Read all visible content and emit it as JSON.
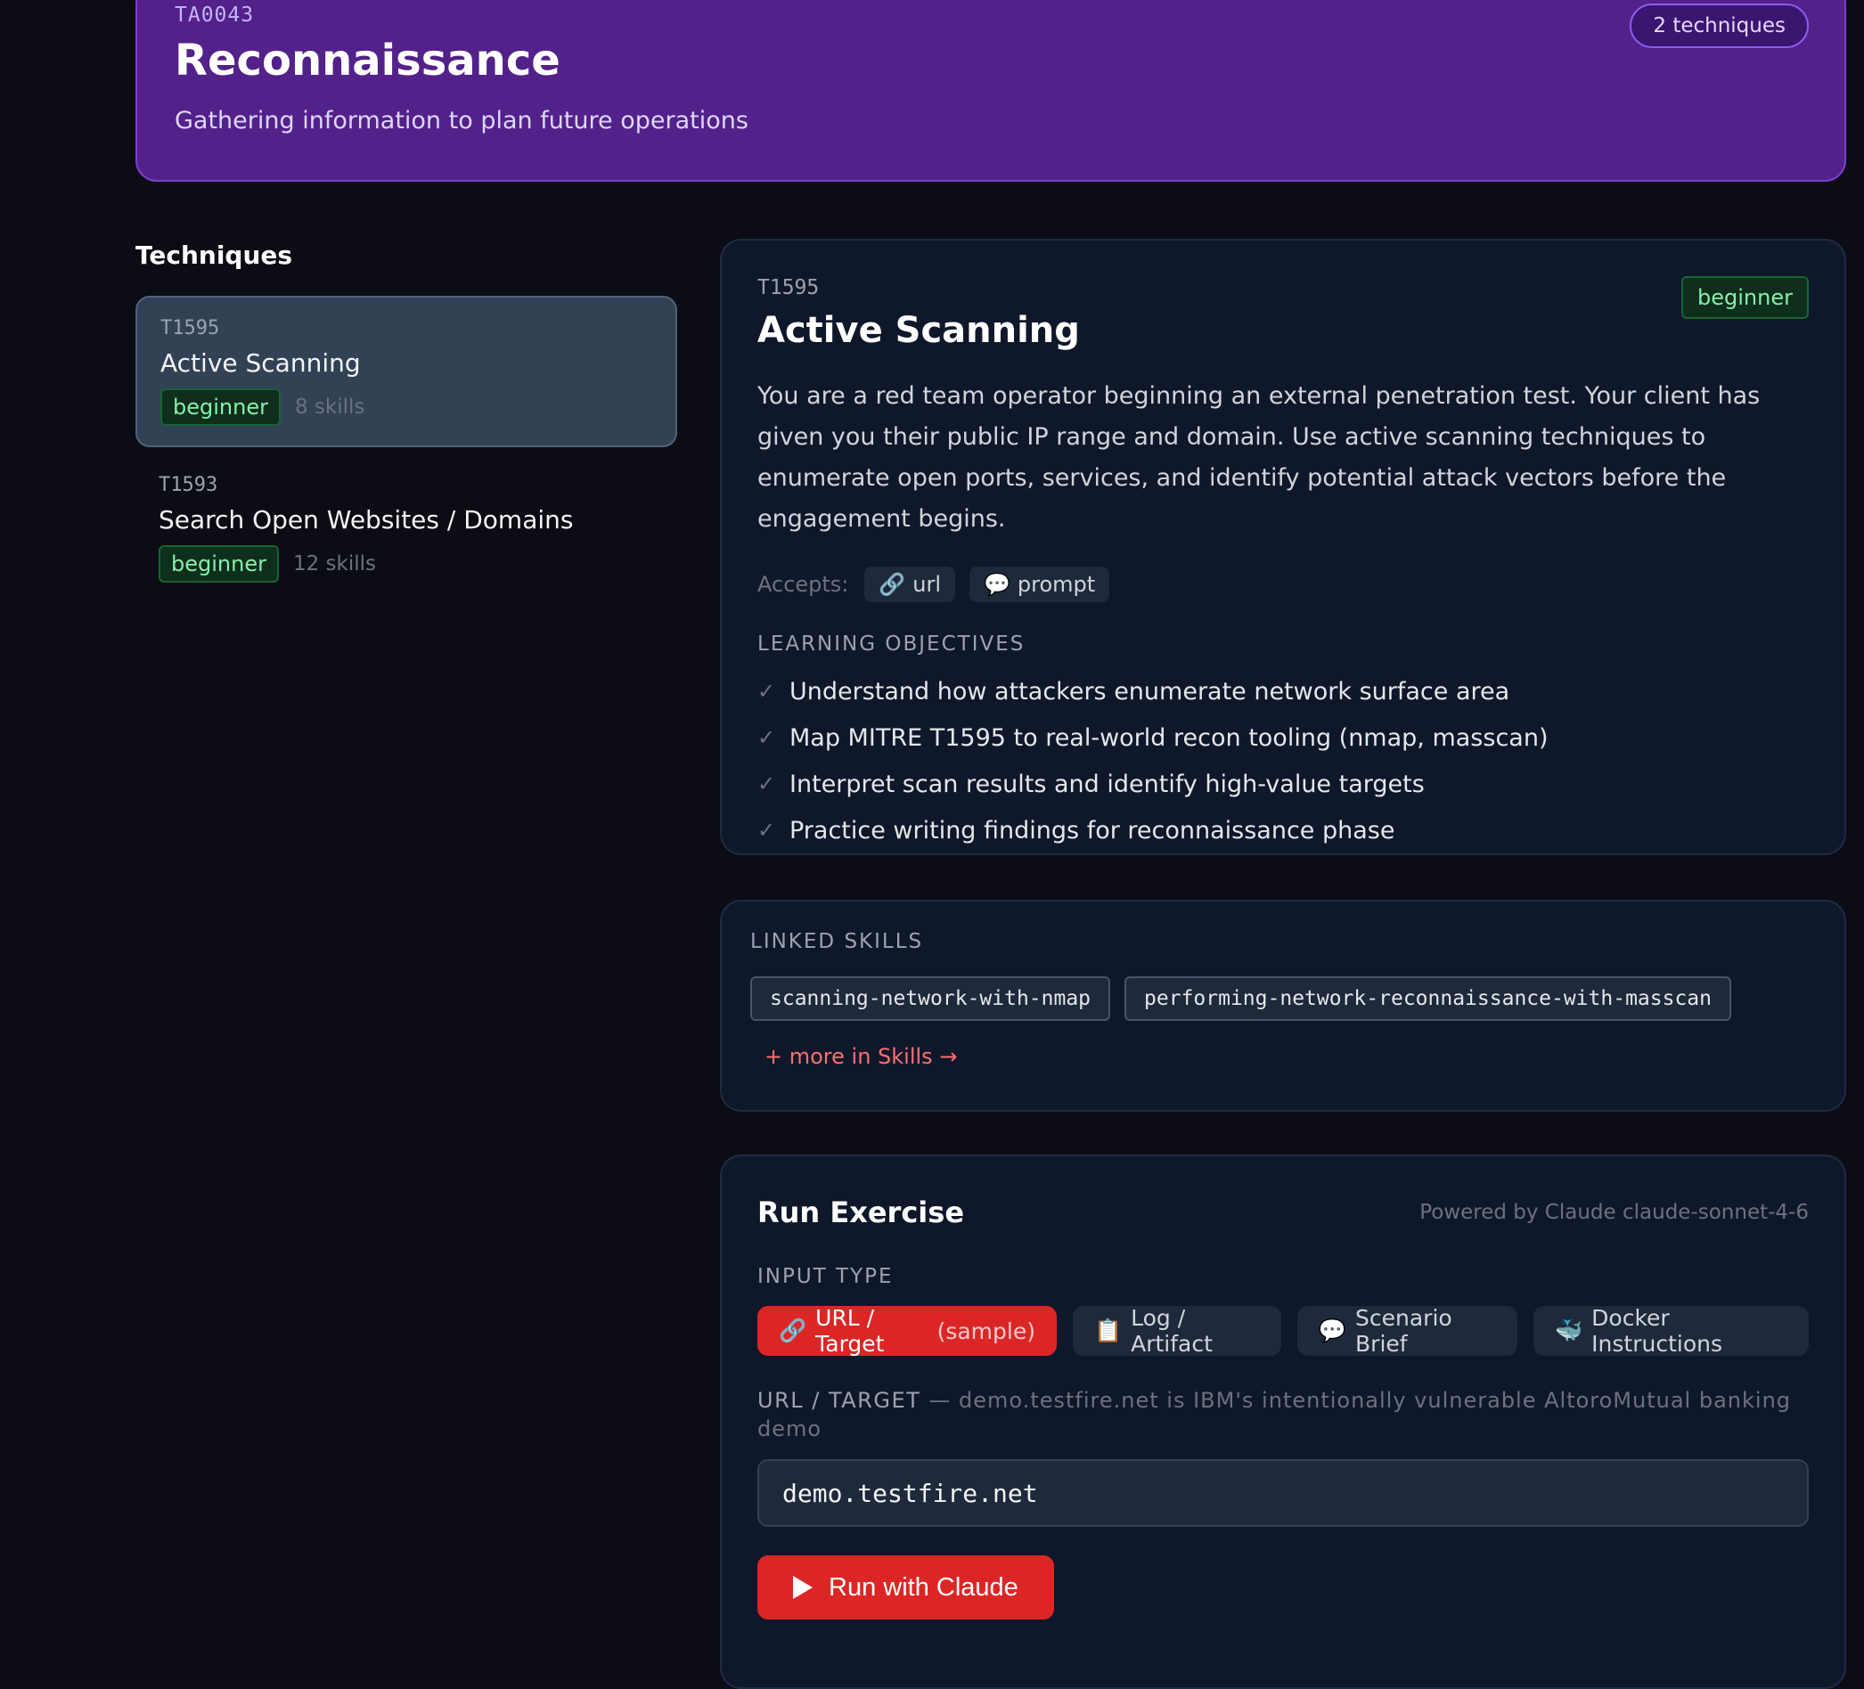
{
  "tactic": {
    "id": "TA0043",
    "title": "Reconnaissance",
    "description": "Gathering information to plan future operations",
    "technique_count": "2 techniques"
  },
  "techniques_heading": "Techniques",
  "techniques": [
    {
      "id": "T1595",
      "name": "Active Scanning",
      "level": "beginner",
      "skills": "8 skills",
      "active": true
    },
    {
      "id": "T1593",
      "name": "Search Open Websites / Domains",
      "level": "beginner",
      "skills": "12 skills",
      "active": false
    }
  ],
  "detail": {
    "id": "T1595",
    "title": "Active Scanning",
    "level": "beginner",
    "scenario": "You are a red team operator beginning an external penetration test. Your client has given you their public IP range and domain. Use active scanning techniques to enumerate open ports, services, and identify potential attack vectors before the engagement begins.",
    "accepts_label": "Accepts:",
    "accepts": [
      {
        "icon": "🔗",
        "label": "url"
      },
      {
        "icon": "💬",
        "label": "prompt"
      }
    ],
    "objectives_label": "LEARNING OBJECTIVES",
    "objectives": [
      "Understand how attackers enumerate network surface area",
      "Map MITRE T1595 to real-world recon tooling (nmap, masscan)",
      "Interpret scan results and identify high-value targets",
      "Practice writing findings for reconnaissance phase"
    ],
    "check_glyph": "✓"
  },
  "linked_skills": {
    "label": "LINKED SKILLS",
    "skills": [
      "scanning-network-with-nmap",
      "performing-network-reconnaissance-with-masscan"
    ],
    "more": "+ more in Skills →"
  },
  "run": {
    "title": "Run Exercise",
    "powered_by": "Powered by Claude claude-sonnet-4-6",
    "input_type_label": "INPUT TYPE",
    "tabs": [
      {
        "icon": "🔗",
        "label": "URL / Target",
        "extra": "(sample)"
      },
      {
        "icon": "📋",
        "label": "Log / Artifact",
        "extra": ""
      },
      {
        "icon": "💬",
        "label": "Scenario Brief",
        "extra": ""
      },
      {
        "icon": "🐳",
        "label": "Docker Instructions",
        "extra": ""
      }
    ],
    "target_label": "URL / TARGET",
    "target_note": "— demo.testfire.net is IBM's intentionally vulnerable AltoroMutual banking demo",
    "target_value": "demo.testfire.net",
    "button_label": "Run with Claude"
  }
}
